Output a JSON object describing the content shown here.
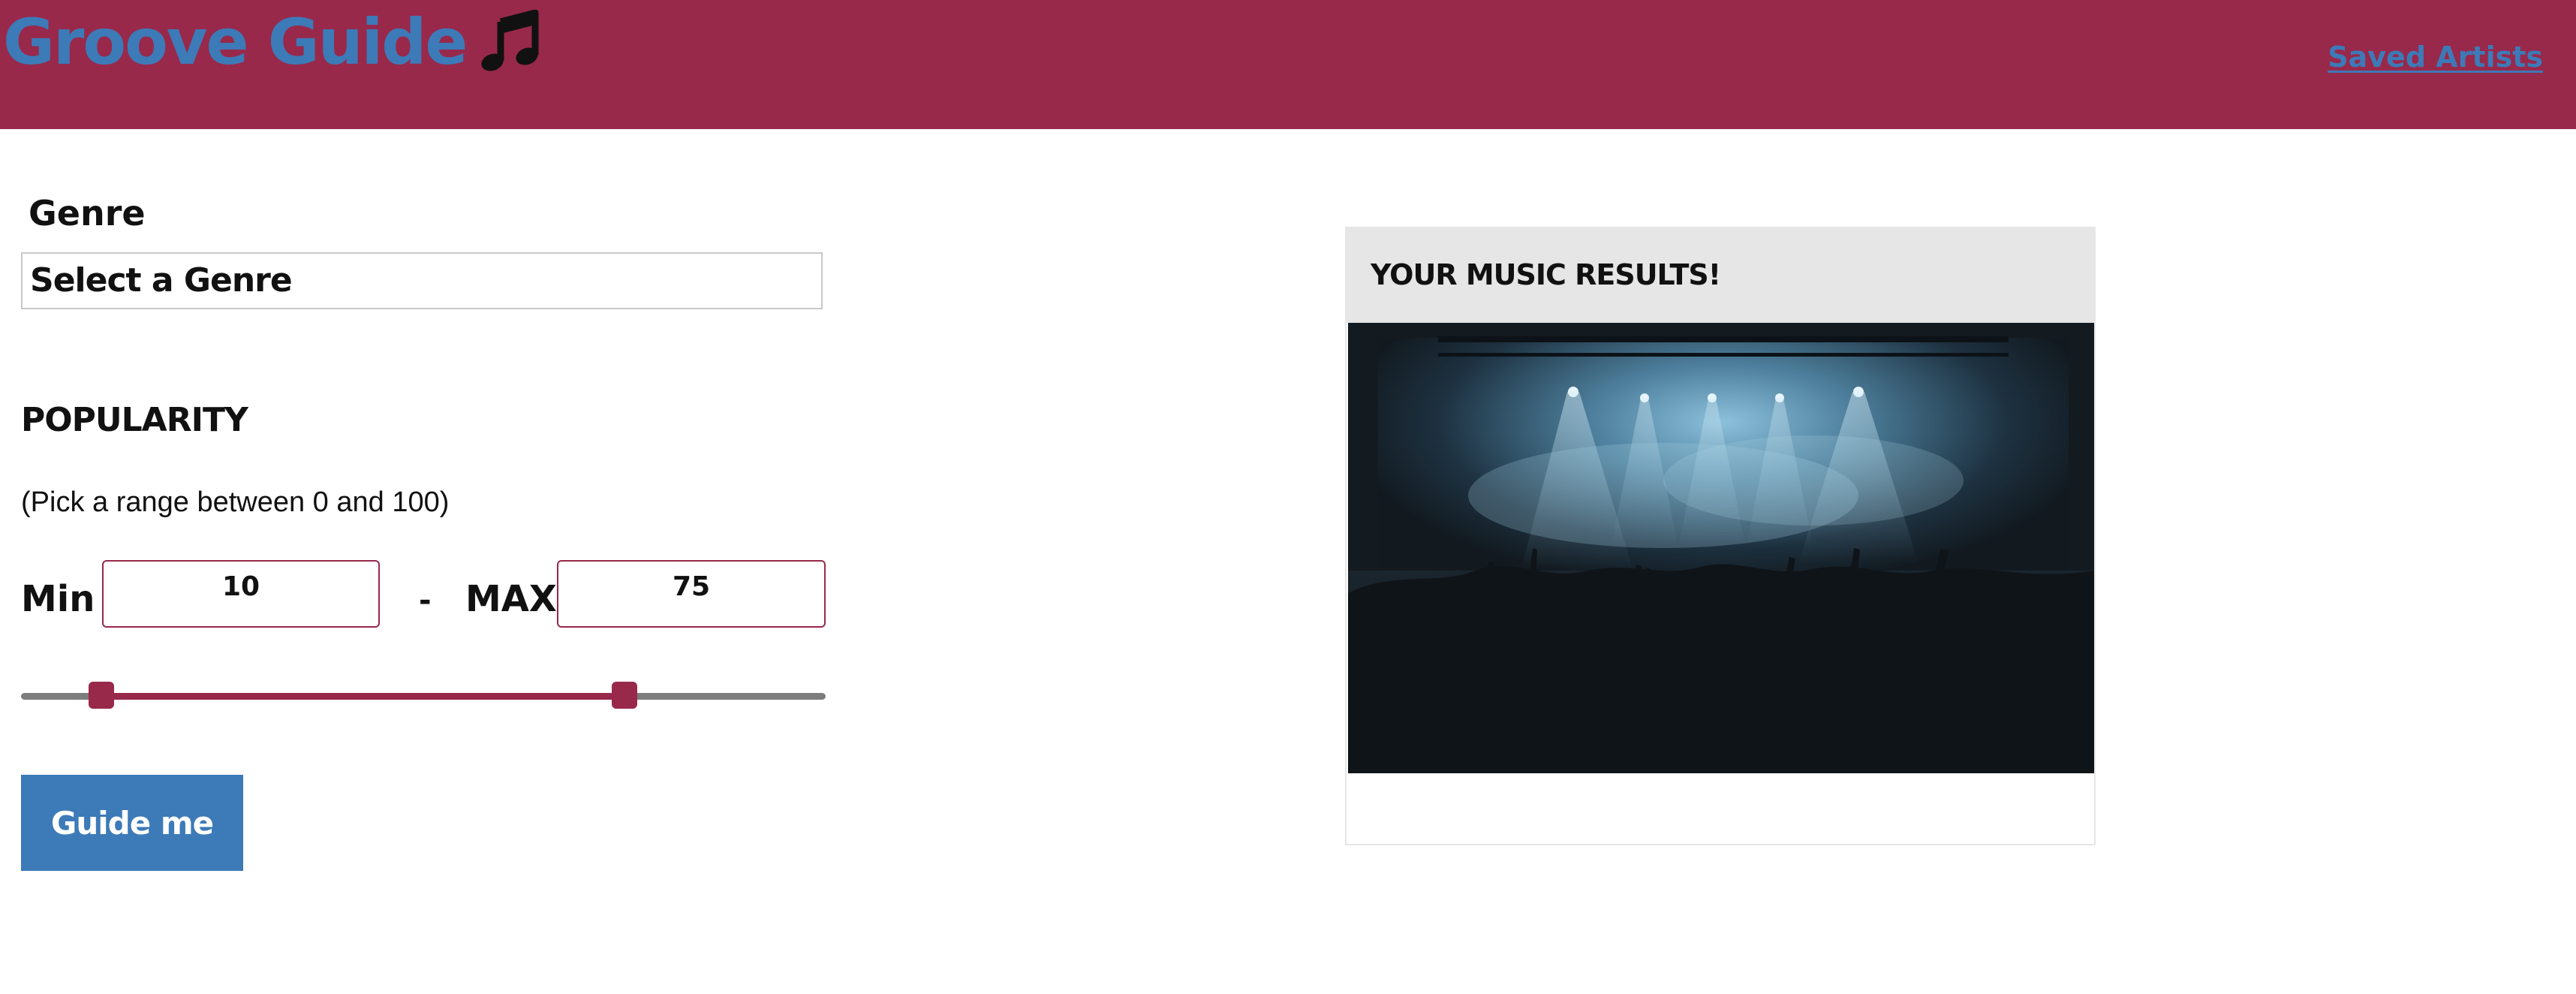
{
  "header": {
    "title": "Groove Guide",
    "brand_icon": "music-note-icon",
    "saved_link": "Saved Artists",
    "bg_color": "#98294b",
    "brand_color": "#3d7ab8"
  },
  "form": {
    "genre_label": "Genre",
    "genre_value": "Select a Genre",
    "popularity_label": "POPULARITY",
    "popularity_help": "(Pick a range between 0 and 100)",
    "min_label": "Min",
    "min_value": "10",
    "dash": "-",
    "max_label": "MAX",
    "max_value": "75",
    "slider": {
      "min": 0,
      "max": 100,
      "low": 10,
      "high": 75
    },
    "submit_label": "Guide me"
  },
  "results": {
    "title": "YOUR MUSIC RESULTS!",
    "image": "concert-crowd-image"
  }
}
